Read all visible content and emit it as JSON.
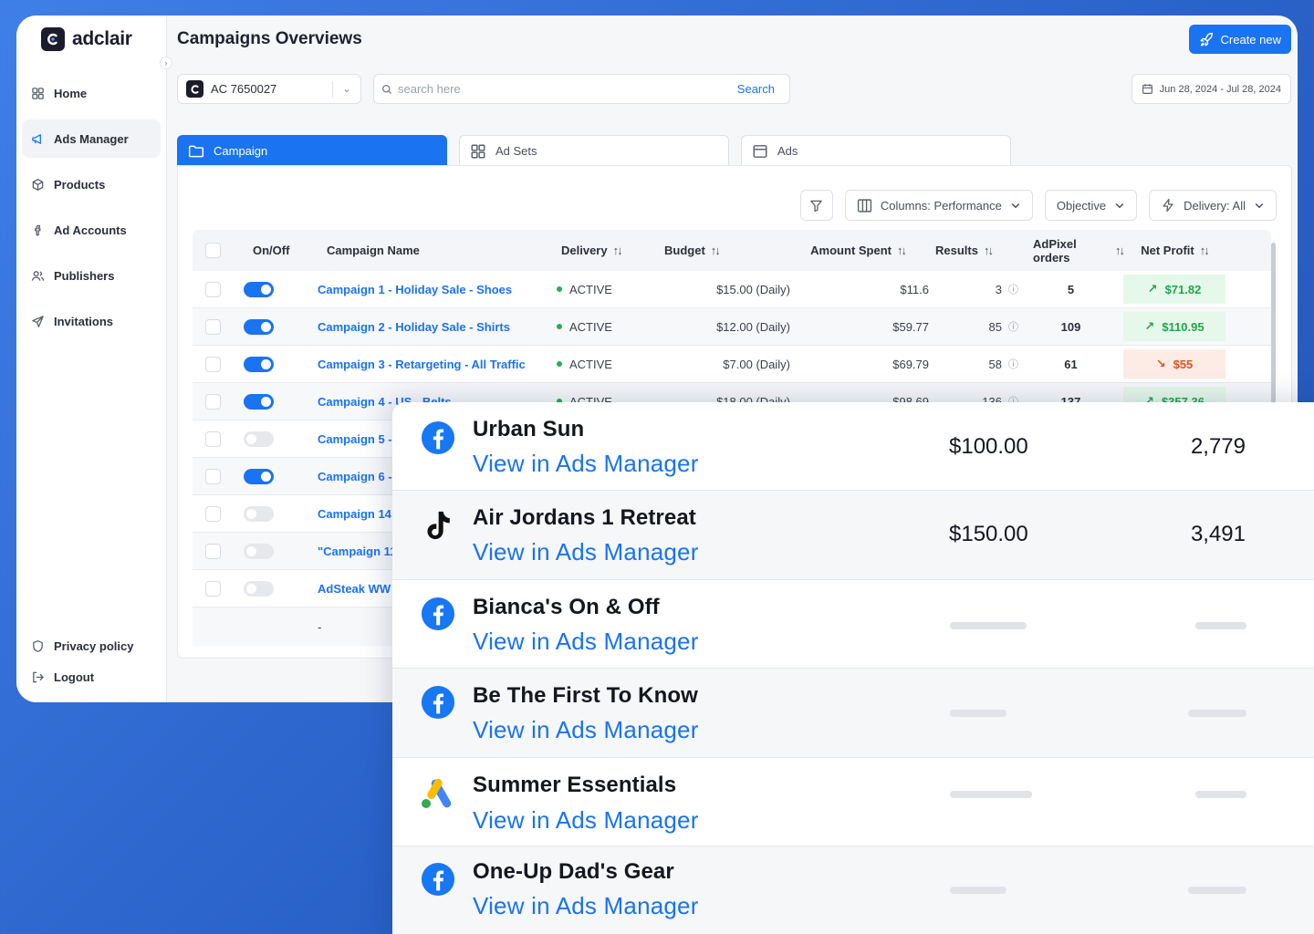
{
  "brand": {
    "name": "adclair"
  },
  "sidebar": {
    "items": [
      {
        "label": "Home",
        "icon": "grid-icon"
      },
      {
        "label": "Ads Manager",
        "icon": "megaphone-icon",
        "active": true
      },
      {
        "label": "Products",
        "icon": "box-icon"
      },
      {
        "label": "Ad Accounts",
        "icon": "facebook-icon"
      },
      {
        "label": "Publishers",
        "icon": "users-icon"
      },
      {
        "label": "Invitations",
        "icon": "send-icon"
      }
    ],
    "bottom": [
      {
        "label": "Privacy policy",
        "icon": "shield-icon"
      },
      {
        "label": "Logout",
        "icon": "logout-icon"
      }
    ]
  },
  "header": {
    "title": "Campaigns Overviews",
    "create_label": "Create new",
    "account": "AC 7650027",
    "search_placeholder": "search here",
    "search_label": "Search",
    "date_range": "Jun 28, 2024 - Jul 28, 2024"
  },
  "tabs": [
    {
      "label": "Campaign",
      "active": true
    },
    {
      "label": "Ad Sets"
    },
    {
      "label": "Ads"
    }
  ],
  "filters": {
    "columns": "Columns: Performance",
    "objective": "Objective",
    "delivery": "Delivery: All"
  },
  "table": {
    "headers": {
      "onoff": "On/Off",
      "name": "Campaign Name",
      "delivery": "Delivery",
      "budget": "Budget",
      "spent": "Amount Spent",
      "results": "Results",
      "adpixel": "AdPixel orders",
      "net": "Net Profit"
    },
    "rows": [
      {
        "on": true,
        "name": "Campaign 1 - Holiday Sale - Shoes",
        "delivery": "ACTIVE",
        "budget": "$15.00 (Daily)",
        "spent": "$11.6",
        "results": "3",
        "adpixel": "5",
        "net": "$71.82",
        "net_dir": "pos"
      },
      {
        "on": true,
        "name": "Campaign 2 - Holiday Sale - Shirts",
        "delivery": "ACTIVE",
        "budget": "$12.00 (Daily)",
        "spent": "$59.77",
        "results": "85",
        "adpixel": "109",
        "net": "$110.95",
        "net_dir": "pos"
      },
      {
        "on": true,
        "name": "Campaign 3 - Retargeting - All Traffic",
        "delivery": "ACTIVE",
        "budget": "$7.00 (Daily)",
        "spent": "$69.79",
        "results": "58",
        "adpixel": "61",
        "net": "$55",
        "net_dir": "neg"
      },
      {
        "on": true,
        "name": "Campaign 4 - US - Belts",
        "delivery": "ACTIVE",
        "budget": "$18.00 (Daily)",
        "spent": "$98.69",
        "results": "136",
        "adpixel": "137",
        "net": "$357.36",
        "net_dir": "pos"
      },
      {
        "on": false,
        "name": "Campaign 5 - U"
      },
      {
        "on": true,
        "name": "Campaign 6 - U"
      },
      {
        "on": false,
        "name": "Campaign 14 -"
      },
      {
        "on": false,
        "name": "\"Campaign 11 -"
      },
      {
        "on": false,
        "name": "AdSteak WW -"
      }
    ],
    "footer": "-"
  },
  "overlay": {
    "rows": [
      {
        "icon": "facebook-icon",
        "title": "Urban Sun",
        "link": "View in Ads Manager",
        "value1": "$100.00",
        "value2": "2,779"
      },
      {
        "icon": "tiktok-icon",
        "title": "Air Jordans 1 Retreat",
        "link": "View in Ads Manager",
        "value1": "$150.00",
        "value2": "3,491"
      },
      {
        "icon": "facebook-icon",
        "title": "Bianca's On & Off",
        "link": "View in Ads Manager"
      },
      {
        "icon": "facebook-icon",
        "title": "Be The First To Know",
        "link": "View in Ads Manager"
      },
      {
        "icon": "google-ads-icon",
        "title": "Summer Essentials",
        "link": "View in Ads Manager"
      },
      {
        "icon": "facebook-icon",
        "title": "One-Up Dad's Gear",
        "link": "View in Ads Manager"
      }
    ]
  },
  "colors": {
    "accent": "#1a73f0",
    "positive": "#1ea74a",
    "negative": "#e5531c",
    "background_gradient": "#3f7fe8"
  }
}
